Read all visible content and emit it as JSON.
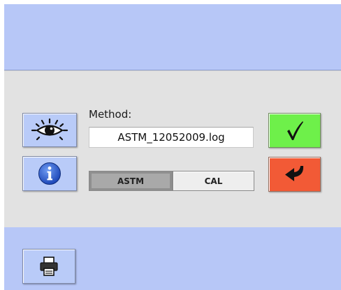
{
  "method": {
    "label": "Method:",
    "value": "ASTM_12052009.log"
  },
  "mode_toggle": {
    "options": [
      "ASTM",
      "CAL"
    ],
    "selected": "ASTM"
  },
  "buttons": {
    "view_icon": "eye-icon",
    "info_icon": "info-icon",
    "confirm_icon": "checkmark-icon",
    "back_icon": "return-arrow-icon",
    "print_icon": "printer-icon"
  },
  "colors": {
    "panel_blue": "#b7c7f7",
    "panel_gray": "#e2e2e2",
    "confirm_green": "#6ef04a",
    "back_red": "#f25a36",
    "info_blue": "#2a5fd6"
  }
}
